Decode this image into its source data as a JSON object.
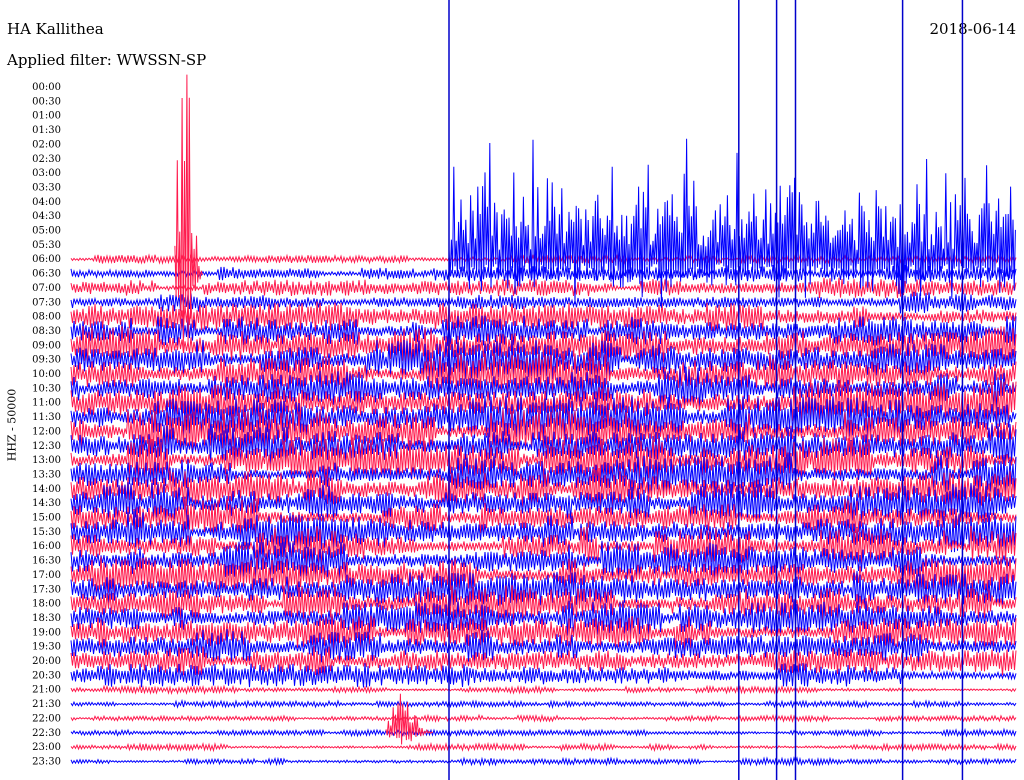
{
  "header": {
    "station": "HA Kallithea",
    "date": "2018-06-14",
    "filter": "Applied filter: WWSSN-SP",
    "channel_label": "HHZ - 50000"
  },
  "colors": {
    "trace_a": "#ff1a4d",
    "trace_b": "#0000ff",
    "marker": "#0000cc"
  },
  "chart_data": {
    "type": "line",
    "title": "HA Kallithea",
    "subtitle": "Applied filter: WWSSN-SP",
    "ylabel": "HHZ - 50000",
    "date": "2018-06-14",
    "row_labels": [
      "00:00",
      "00:30",
      "01:00",
      "01:30",
      "02:00",
      "02:30",
      "03:00",
      "03:30",
      "04:00",
      "04:30",
      "05:00",
      "05:30",
      "06:00",
      "06:30",
      "07:00",
      "07:30",
      "08:00",
      "08:30",
      "09:00",
      "09:30",
      "10:00",
      "10:30",
      "11:00",
      "11:30",
      "12:00",
      "12:30",
      "13:00",
      "13:30",
      "14:00",
      "14:30",
      "15:00",
      "15:30",
      "16:00",
      "16:30",
      "17:00",
      "17:30",
      "18:00",
      "18:30",
      "19:00",
      "19:30",
      "20:00",
      "20:30",
      "21:00",
      "21:30",
      "22:00",
      "22:30",
      "23:00",
      "23:30"
    ],
    "series": [
      {
        "rows": "even-indexed rows",
        "color": "#ff1a4d"
      },
      {
        "rows": "odd-indexed rows",
        "color": "#0000ff"
      }
    ],
    "traces_start_row": "06:00",
    "relative_amplitude": [
      0,
      0,
      0,
      0,
      0,
      0,
      0,
      0,
      0,
      0,
      0,
      0,
      3,
      5,
      6,
      7,
      9,
      10,
      11,
      12,
      13,
      13,
      13,
      13,
      13,
      13,
      13,
      12,
      12,
      12,
      12,
      12,
      12,
      12,
      11,
      11,
      11,
      11,
      11,
      10,
      9,
      7,
      2,
      2,
      2,
      2,
      2,
      2
    ],
    "events": [
      {
        "row": "06:30",
        "start_min": 3.3,
        "end_min": 4.2,
        "peak": "high",
        "color": "#ff1a4d"
      },
      {
        "row": "06:00",
        "start_min": 12.0,
        "end_min": 30,
        "peak": "very high",
        "color": "#0000ff"
      },
      {
        "row": "22:30",
        "start_min": 10.0,
        "end_min": 11.5,
        "peak": "medium",
        "color": "#ff1a4d"
      }
    ],
    "vertical_markers_min": [
      12.0,
      21.2,
      22.4,
      23.0,
      26.4,
      28.3
    ],
    "grid": false
  }
}
